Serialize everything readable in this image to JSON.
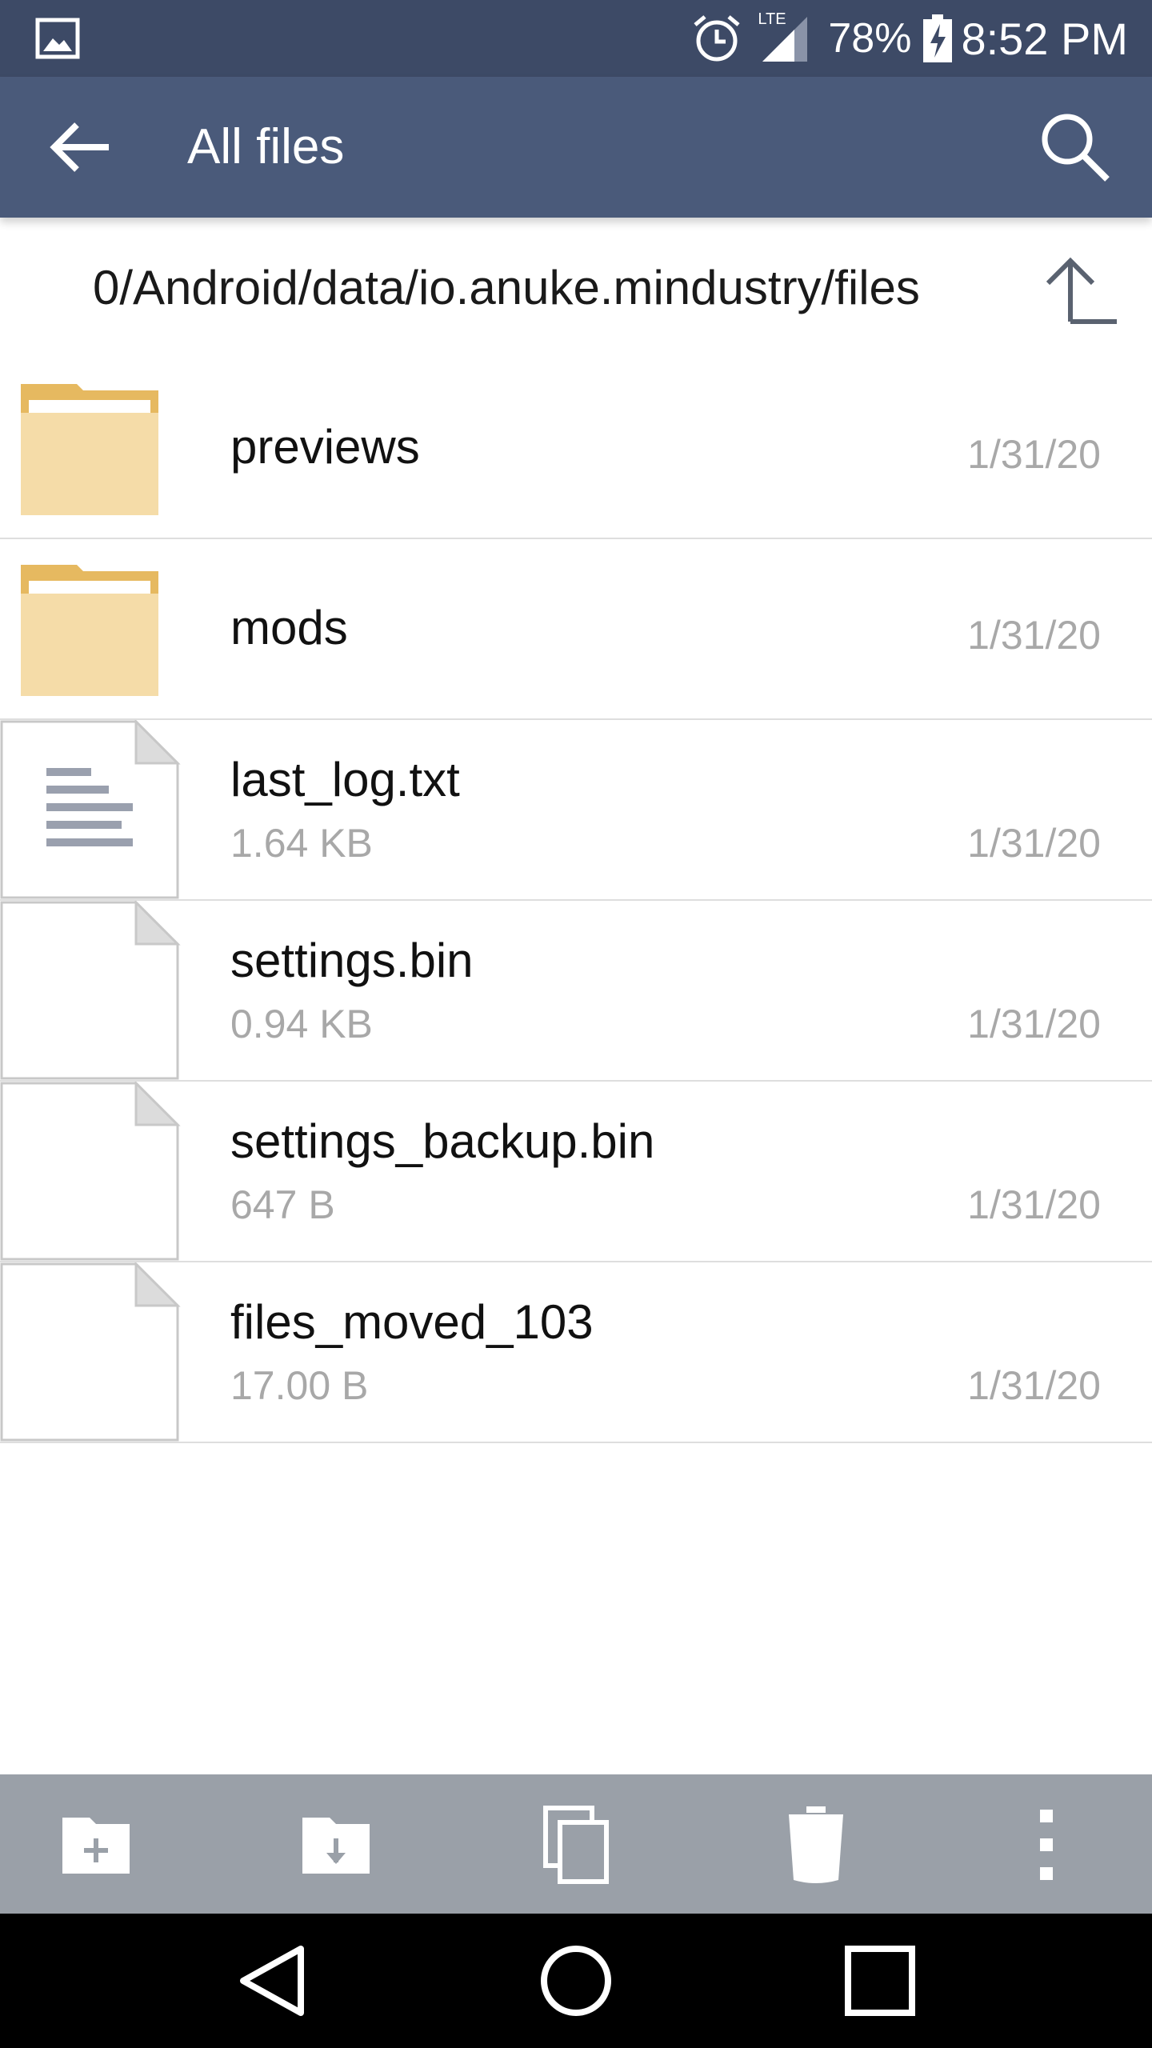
{
  "status_bar": {
    "network": "LTE",
    "battery_percent": "78%",
    "time": "8:52 PM"
  },
  "app_bar": {
    "title": "All files"
  },
  "path_bar": {
    "path": "0/Android/data/io.anuke.mindustry/files"
  },
  "files": [
    {
      "name": "previews",
      "type": "folder",
      "size": "",
      "date": "1/31/20"
    },
    {
      "name": "mods",
      "type": "folder",
      "size": "",
      "date": "1/31/20"
    },
    {
      "name": "last_log.txt",
      "type": "text",
      "size": "1.64 KB",
      "date": "1/31/20"
    },
    {
      "name": "settings.bin",
      "type": "file",
      "size": "0.94 KB",
      "date": "1/31/20"
    },
    {
      "name": "settings_backup.bin",
      "type": "file",
      "size": "647 B",
      "date": "1/31/20"
    },
    {
      "name": "files_moved_103",
      "type": "file",
      "size": "17.00 B",
      "date": "1/31/20"
    }
  ],
  "toolbar": {
    "items": [
      "new-folder-icon",
      "download-folder-icon",
      "copy-icon",
      "trash-icon",
      "more-vertical-icon"
    ]
  },
  "colors": {
    "status_bar": "#3d4a66",
    "app_bar": "#4a5a7a",
    "folder": "#f5dca8",
    "folder_tab": "#e6b960",
    "toolbar": "#9aa0a8",
    "secondary_text": "#a8a8a8"
  }
}
